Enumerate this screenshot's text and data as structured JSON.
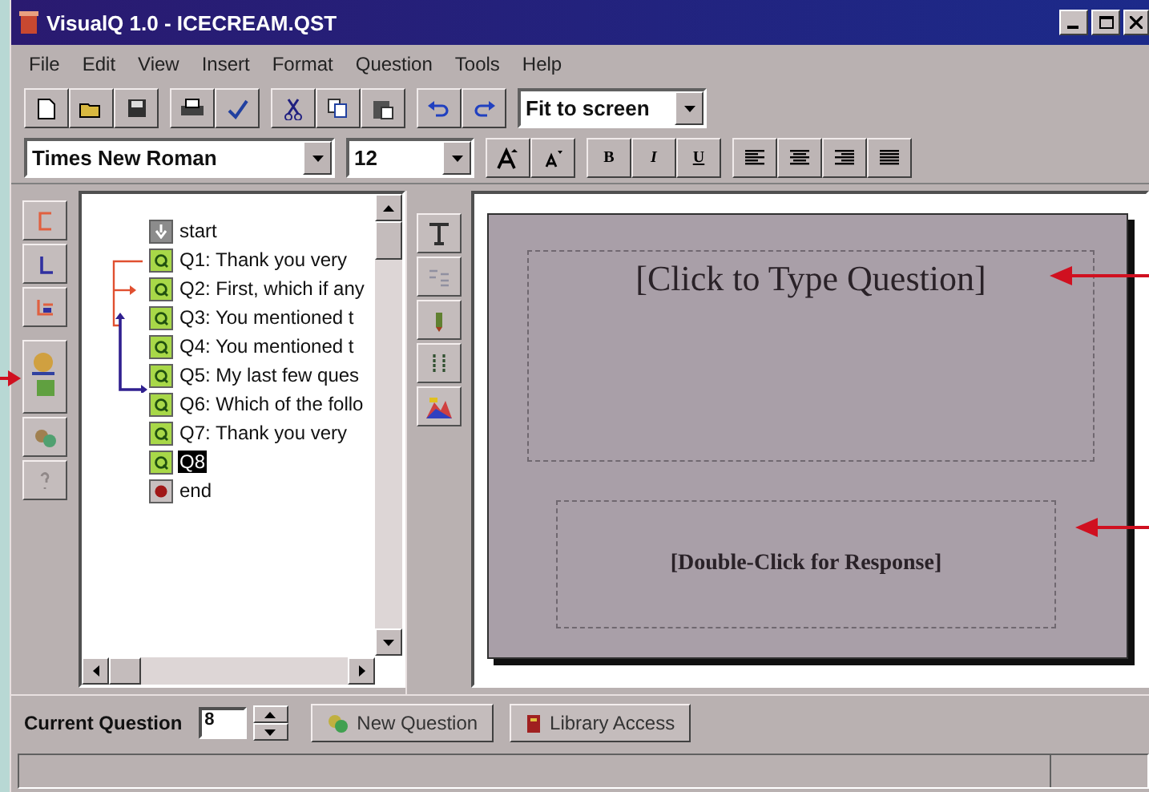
{
  "window": {
    "title": "VisualQ 1.0 - ICECREAM.QST"
  },
  "menu": [
    "File",
    "Edit",
    "View",
    "Insert",
    "Format",
    "Question",
    "Tools",
    "Help"
  ],
  "toolbar": {
    "zoom": "Fit to screen"
  },
  "format_bar": {
    "font": "Times New Roman",
    "size": "12",
    "styles": [
      "B",
      "I",
      "U"
    ]
  },
  "tree": [
    {
      "kind": "start",
      "label": "start",
      "selected": false
    },
    {
      "kind": "question",
      "label": "Q1: Thank you very",
      "selected": false
    },
    {
      "kind": "question",
      "label": "Q2: First, which if any",
      "selected": false
    },
    {
      "kind": "question",
      "label": "Q3: You mentioned t",
      "selected": false
    },
    {
      "kind": "question",
      "label": "Q4: You mentioned t",
      "selected": false
    },
    {
      "kind": "question",
      "label": "Q5: My last few ques",
      "selected": false
    },
    {
      "kind": "question",
      "label": "Q6: Which of the follo",
      "selected": false
    },
    {
      "kind": "question",
      "label": "Q7: Thank you very",
      "selected": false
    },
    {
      "kind": "question",
      "label": "Q8",
      "selected": true
    },
    {
      "kind": "end",
      "label": "end",
      "selected": false
    }
  ],
  "canvas": {
    "question_placeholder": "[Click to Type Question]",
    "response_placeholder": "[Double-Click for Response]"
  },
  "bottom": {
    "label": "Current Question",
    "value": "8",
    "buttons": [
      "New Question",
      "Library Access"
    ]
  }
}
